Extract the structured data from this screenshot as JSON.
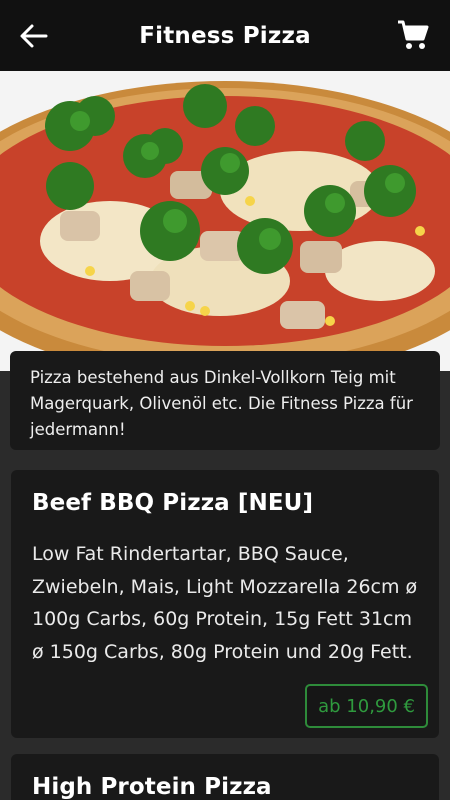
{
  "header": {
    "title": "Fitness Pizza",
    "back_icon": "arrow-left-icon",
    "cart_icon": "shopping-cart-icon"
  },
  "category": {
    "description": "Pizza bestehend aus Dinkel-Vollkorn Teig mit Magerquark, Olivenöl etc. Die Fitness Pizza für jedermann!"
  },
  "products": [
    {
      "name": "Beef BBQ Pizza [NEU]",
      "description": "Low Fat Rindertartar, BBQ Sauce, Zwiebeln, Mais, Light Mozzarella 26cm ø 100g Carbs, 60g Protein, 15g Fett 31cm ø 150g Carbs, 80g Protein und 20g Fett.",
      "price": "ab 10,90 €"
    },
    {
      "name": "High Protein Pizza"
    }
  ],
  "colors": {
    "topbar": "#111111",
    "background": "#2b2b2b",
    "card": "#191919",
    "price_accent": "#2e8b3a"
  }
}
